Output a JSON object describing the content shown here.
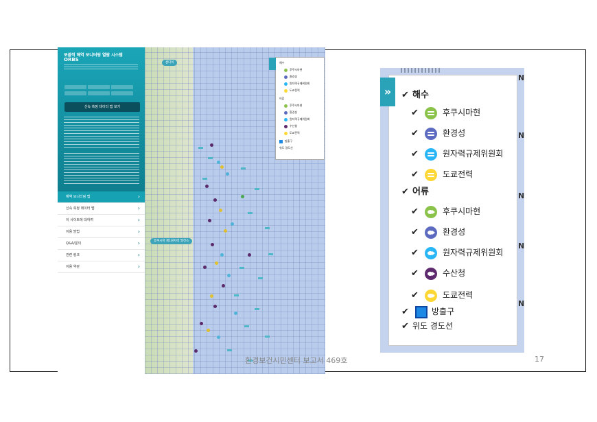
{
  "screenshot": {
    "system_title": "포괄적 해역 모니터링 열람 시스템",
    "system_brand": "ORBS",
    "main_button": "신속 측정 데이터 맵 보기",
    "map_top_label": "센다이",
    "map_pin_label": "후쿠시마 제1원자력 발전소",
    "menu": [
      "해역 모니터링 맵",
      "신속 측정 데이터 맵",
      "이 사이트에 대하여",
      "이용 방법",
      "Q&A/문의",
      "관련 링크",
      "이용 약관"
    ],
    "mini_legend": {
      "seawater": "해수",
      "seawater_items": [
        "후쿠시마현",
        "환경성",
        "원자력규제위원회",
        "도쿄전력"
      ],
      "fish": "어류",
      "fish_items": [
        "후쿠시마현",
        "환경성",
        "원자력규제위원회",
        "수산청",
        "도쿄전력"
      ],
      "outlet": "방출구",
      "gridlines": "위도 경도선"
    }
  },
  "legend": {
    "seawater_header": "해수",
    "seawater_items": [
      {
        "label": "후쿠시마현",
        "color": "#8bc34a"
      },
      {
        "label": "환경성",
        "color": "#5c6bc0"
      },
      {
        "label": "원자력규제위원회",
        "color": "#29b6f6"
      },
      {
        "label": "도쿄전력",
        "color": "#fdd835"
      }
    ],
    "fish_header": "어류",
    "fish_items": [
      {
        "label": "후쿠시마현",
        "color": "#8bc34a"
      },
      {
        "label": "환경성",
        "color": "#5c6bc0"
      },
      {
        "label": "원자력규제위원회",
        "color": "#29b6f6"
      },
      {
        "label": "수산청",
        "color": "#5e2a6e"
      },
      {
        "label": "도쿄전력",
        "color": "#fdd835"
      }
    ],
    "outlet_label": "방출구",
    "outlet_color": "#1e88e5",
    "gridlines_label": "위도 경도선",
    "check_glyph": "✔",
    "expand_glyph": "»",
    "edge_letter": "N"
  },
  "footer": {
    "caption": "환경보건시민센터 보고서 469호",
    "page_number": "17"
  }
}
